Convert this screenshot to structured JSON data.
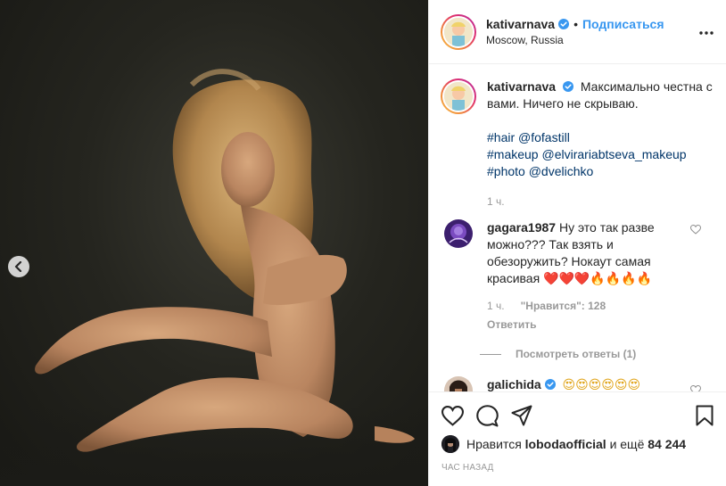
{
  "post": {
    "username": "kativarnava",
    "follow_label": "Подписаться",
    "separator": "•",
    "location": "Moscow, Russia"
  },
  "caption": {
    "username": "kativarnava",
    "text": "Максимально честна с вами. Ничего не скрываю.",
    "tags": [
      {
        "hashtag": "#hair",
        "mention": "@fofastill"
      },
      {
        "hashtag": "#makeup",
        "mention": "@elvirariabtseva_makeup"
      },
      {
        "hashtag": "#photo",
        "mention": "@dvelichko"
      }
    ],
    "time": "1 ч."
  },
  "comments": [
    {
      "username": "gagara1987",
      "text": "Ну это так разве можно??? Так взять и обезоружить? Нокаут самая красивая ❤️❤️❤️🔥🔥🔥🔥",
      "time": "1 ч.",
      "likes": "\"Нравится\": 128",
      "reply": "Ответить",
      "view_replies": "Посмотреть ответы (1)"
    },
    {
      "username": "galichida",
      "text": "😍😍😍😍😍😍"
    }
  ],
  "actions": {
    "liked_by_prefix": "Нравится",
    "liked_by_user": "lobodaofficial",
    "liked_by_suffix": "и ещё",
    "likes_count": "84 244",
    "posted_ago": "ЧАС НАЗАД"
  },
  "icons": [
    "chevron-left-icon",
    "more-icon",
    "verified-icon",
    "heart-icon",
    "comment-icon",
    "share-icon",
    "bookmark-icon"
  ],
  "colors": {
    "link": "#3897f0",
    "verified": "#3897f0",
    "muted": "#999999",
    "border": "#efefef"
  }
}
